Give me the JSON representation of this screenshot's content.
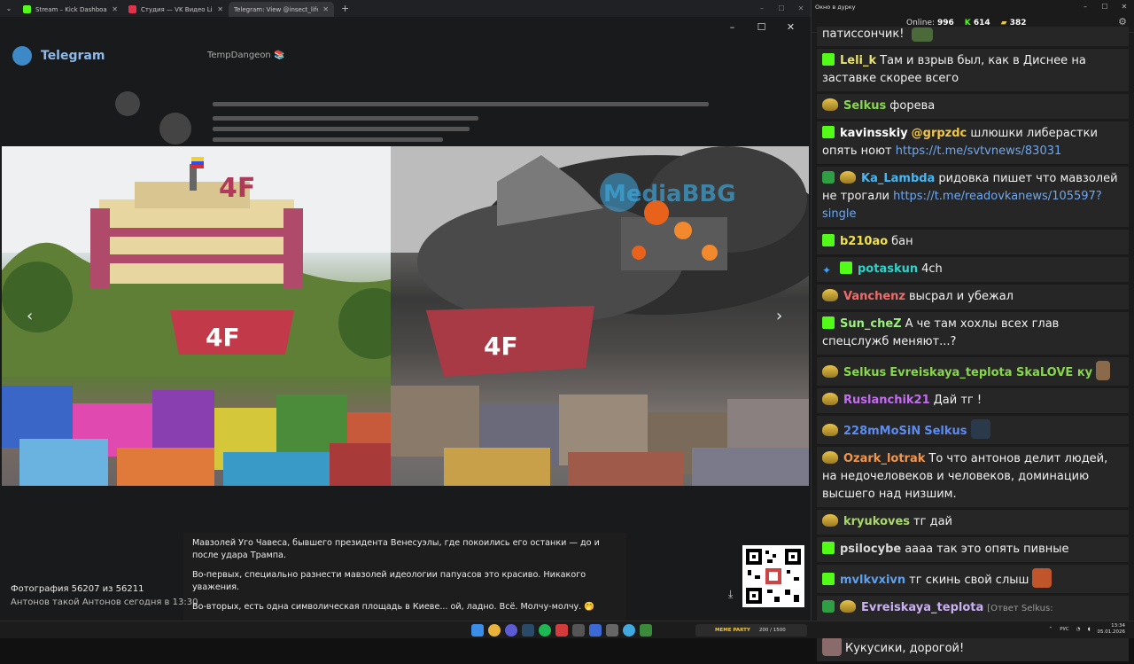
{
  "browser": {
    "tabs": [
      {
        "title": "Stream – Kick Dashboard",
        "color": "#53fc18"
      },
      {
        "title": "Студия — VK Видео Live",
        "color": "#e0334a"
      },
      {
        "title": "Telegram: View @insect_life",
        "color": "#4a4a4a"
      }
    ],
    "new_tab": "+"
  },
  "telegram": {
    "app_title": "Telegram",
    "photo_counter": "Фотография 56207 из 56211",
    "author_time": "Антонов такой Антонов   сегодня в 13:30",
    "caption": [
      "Мавзолей Уго Чавеса, бывшего президента Венесуэлы, где покоились его останки — до и после удара Трампа.",
      "Во-первых, специально разнести мавзолей идеологии папуасов это красиво. Никакого уважения.",
      "Во-вторых, есть одна символическая площадь в Киеве... ой, ладно. Всё. Молчу-молчу. 🤭"
    ],
    "watermark": "MediaBBG",
    "sign_text": "4F"
  },
  "chat": {
    "window_title": "Окно в дурку",
    "online_label": "Online:",
    "online_count": "996",
    "kick_viewers": "614",
    "vk_viewers": "382",
    "messages": [
      {
        "user": "",
        "text": "патиссончик!",
        "badge": "none",
        "emote": "none"
      },
      {
        "user": "Leli_k",
        "color": "#e9e36a",
        "text": "Там и взрыв был, как в Диснее на заставке скорее всего",
        "badge": "kick"
      },
      {
        "user": "Selkus",
        "color": "#86d84a",
        "text": "форева",
        "badge": "emote"
      },
      {
        "user": "kavinsskiy",
        "color": "#ffffff",
        "mention": "@grpzdc",
        "text": "шлюшки либерастки опять ноют",
        "link": "https://t.me/svtvnews/83031",
        "badge": "kick"
      },
      {
        "user": "Ka_Lambda",
        "color": "#47b6f2",
        "text": "ридовка пишет что мавзолей не трогали",
        "link": "https://t.me/readovkanews/105597?single",
        "badge": "shield"
      },
      {
        "user": "b210ao",
        "color": "#f2e14c",
        "text": "бан",
        "badge": "kick"
      },
      {
        "user": "potaskun",
        "color": "#2fd1c8",
        "text": "4ch",
        "badge": "sword"
      },
      {
        "user": "Vanchenz",
        "color": "#f26b6b",
        "text": "высрал и убежал",
        "badge": "emote"
      },
      {
        "user": "Sun_cheZ",
        "color": "#9af27a",
        "text": "А че там хохлы всех глав спецслужб меняют...?",
        "badge": "kick"
      },
      {
        "user": "Selkus",
        "color": "#86d84a",
        "text": "Evreiskaya_teplota SkaLOVE ку",
        "badge": "emote"
      },
      {
        "user": "Ruslanchik21",
        "color": "#c56cf2",
        "text": "Дай тг !",
        "badge": "emote"
      },
      {
        "user": "228mMoSiN",
        "color": "#5c8cf2",
        "text": "Selkus",
        "badge": "emote"
      },
      {
        "user": "Ozark_lotrak",
        "color": "#f2954c",
        "text": "То что антонов делит людей, на недочеловеков и человеков, доминацию высшего над низшим.",
        "badge": "emote"
      },
      {
        "user": "kryukoves",
        "color": "#a8d86a",
        "text": "тг дай",
        "badge": "emote"
      },
      {
        "user": "psilocybe",
        "color": "#d8d8d8",
        "text": "аааа так это опять пивные",
        "badge": "kick"
      },
      {
        "user": "mvlkvxivn",
        "color": "#5ca0f2",
        "text": "тг скинь свой слыш",
        "badge": "kick"
      },
      {
        "user": "Evreiskaya_teplota",
        "color": "#c9b0f2",
        "reply": "[Ответ Selkus: Evreiskaya_teplota SkaLOVE ку]",
        "text": "Кукусики, дорогой!",
        "badge": "shield"
      }
    ]
  },
  "taskbar": {
    "widget_name": "MEME PARTY",
    "widget_progress": "200 / 1500",
    "lang": "РУС",
    "time": "13:34",
    "date": "05.01.2026"
  }
}
